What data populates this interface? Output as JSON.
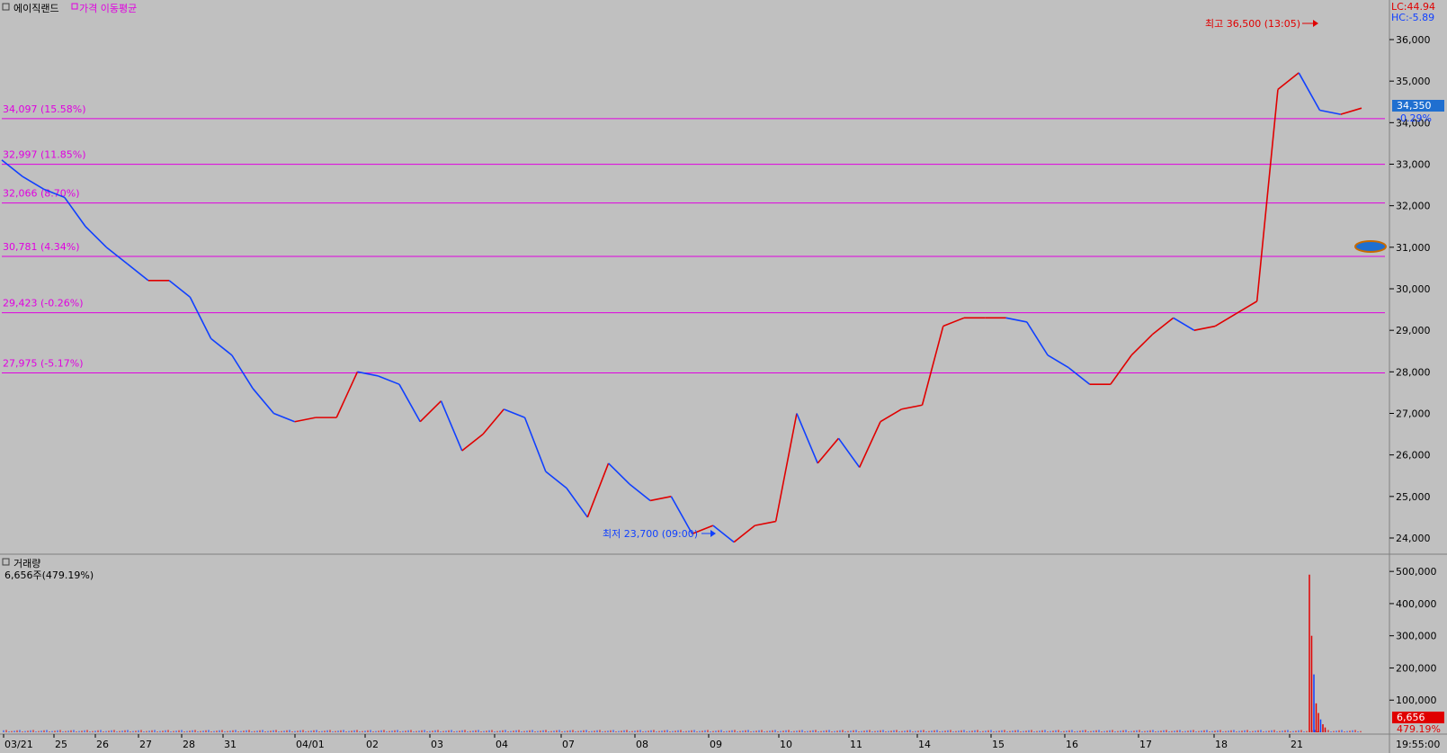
{
  "chart_data": {
    "type": "line",
    "title": "에이직랜드",
    "indicator_label": "가격 이동평균",
    "lc_label": "LC:44.94",
    "hc_label": "HC:-5.89",
    "current_price_label": "34,350",
    "current_change_label": "-0.29%",
    "high_annotation": "최고 36,500 (13:05)",
    "low_annotation": "최저 23,700 (09:00)",
    "price_axis": {
      "min": 23500,
      "max": 36500,
      "ticks": [
        24000,
        25000,
        26000,
        27000,
        28000,
        29000,
        30000,
        31000,
        32000,
        33000,
        34000,
        35000,
        36000
      ],
      "tick_labels": [
        "24,000",
        "25,000",
        "26,000",
        "27,000",
        "28,000",
        "29,000",
        "30,000",
        "31,000",
        "32,000",
        "33,000",
        "34,000",
        "35,000",
        "36,000"
      ]
    },
    "levels": [
      {
        "value": 34097,
        "label": "34,097 (15.58%)"
      },
      {
        "value": 32997,
        "label": "32,997 (11.85%)"
      },
      {
        "value": 32066,
        "label": "32,066 (8.70%)"
      },
      {
        "value": 30781,
        "label": "30,781 (4.34%)"
      },
      {
        "value": 29423,
        "label": "29,423 (-0.26%)"
      },
      {
        "value": 27975,
        "label": "27,975 (-5.17%)"
      }
    ],
    "x_labels": [
      "03/21",
      "25",
      "26",
      "27",
      "28",
      "31",
      "04/01",
      "02",
      "03",
      "04",
      "07",
      "08",
      "09",
      "10",
      "11",
      "14",
      "15",
      "16",
      "17",
      "18",
      "21"
    ],
    "time_label": "19:55:00",
    "series": [
      {
        "values": [
          33100,
          32700,
          32400,
          32200,
          31500,
          31000,
          30600,
          30200,
          30200,
          29800,
          28800,
          28400,
          27600,
          27000,
          26800,
          26900,
          26900,
          28000,
          27900,
          27700,
          26800,
          27300,
          26100,
          26500,
          27100,
          26900,
          25600,
          25200,
          24500,
          25800,
          25300,
          24900,
          25000,
          24100,
          24300,
          23900,
          24300,
          24400,
          27000,
          25800,
          26400,
          25700,
          26800,
          27100,
          27200,
          29100,
          29300,
          29300,
          29300,
          29200,
          28400,
          28100,
          27700,
          27700,
          28400,
          28900,
          29300,
          29000,
          29100,
          29400,
          29700,
          34800,
          35200,
          34300,
          34200,
          34350
        ]
      }
    ],
    "volume": {
      "title": "거래량",
      "summary": "6,656주(479.19%)",
      "current_label": "6,656",
      "current_pct_label": "479.19%",
      "axis": {
        "max": 500000,
        "ticks": [
          100000,
          200000,
          300000,
          400000,
          500000
        ],
        "tick_labels": [
          "100,000",
          "200,000",
          "300,000",
          "400,000",
          "500,000"
        ]
      },
      "spikes": [
        {
          "day_index": 20,
          "value": 490000,
          "color": "#e00000"
        },
        {
          "day_index": 20,
          "value": 300000,
          "color": "#e00000"
        },
        {
          "day_index": 20,
          "value": 180000,
          "color": "#1040ff"
        },
        {
          "day_index": 20,
          "value": 90000,
          "color": "#e00000"
        },
        {
          "day_index": 20,
          "value": 60000,
          "color": "#e00000"
        },
        {
          "day_index": 20,
          "value": 40000,
          "color": "#1040ff"
        },
        {
          "day_index": 20,
          "value": 25000,
          "color": "#e00000"
        },
        {
          "day_index": 20,
          "value": 15000,
          "color": "#e00000"
        }
      ]
    },
    "colors": {
      "up": "#e00000",
      "down": "#1040ff",
      "level": "#e000e0",
      "price_tag": "#1f6fd0",
      "volume_tag": "#e00000"
    }
  }
}
